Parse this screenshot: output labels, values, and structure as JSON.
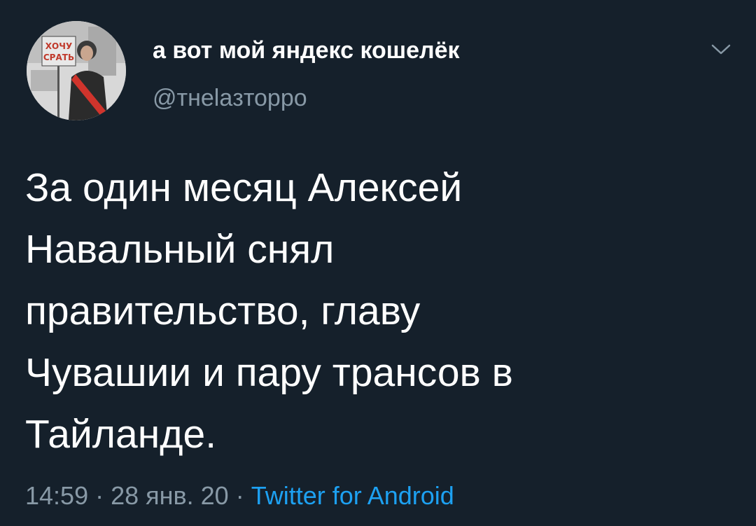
{
  "author": {
    "display_name": "а вот мой яндекс кошелёк",
    "handle": "@тнеlaзторро",
    "avatar_sign_text": "ХОЧУ СРАТЬ"
  },
  "tweet": {
    "lines": [
      "За один месяц Алексей",
      "Навальный снял",
      "правительство, главу",
      "Чувашии и пару трансов в",
      "Тайланде."
    ]
  },
  "meta": {
    "time": "14:59",
    "separator": " · ",
    "date": "28 янв. 20",
    "source": "Twitter for Android"
  },
  "icons": {
    "menu": "chevron-down-icon"
  },
  "colors": {
    "background": "#15202b",
    "text": "#ffffff",
    "muted": "#8899a6",
    "link": "#1da1f2"
  }
}
